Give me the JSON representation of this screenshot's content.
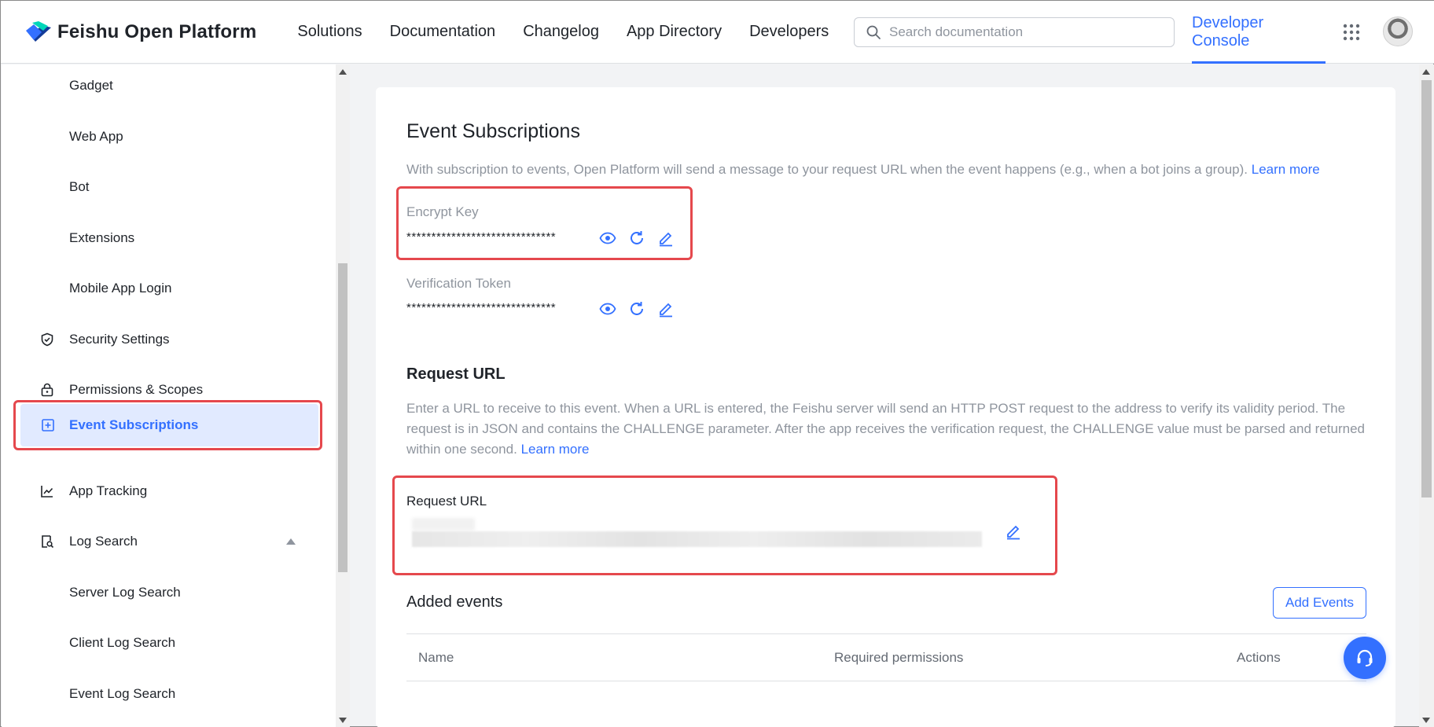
{
  "header": {
    "brand": "Feishu Open Platform",
    "nav": [
      "Solutions",
      "Documentation",
      "Changelog",
      "App Directory",
      "Developers"
    ],
    "search_placeholder": "Search documentation",
    "developer_console": "Developer Console"
  },
  "sidebar": {
    "items": [
      {
        "label": "Gadget",
        "icon": ""
      },
      {
        "label": "Web App",
        "icon": ""
      },
      {
        "label": "Bot",
        "icon": ""
      },
      {
        "label": "Extensions",
        "icon": ""
      },
      {
        "label": "Mobile App Login",
        "icon": ""
      },
      {
        "label": "Security Settings",
        "icon": "shield-check-icon"
      },
      {
        "label": "Permissions & Scopes",
        "icon": "lock-icon"
      },
      {
        "label": "Event Subscriptions",
        "icon": "plus-square-icon",
        "active": true
      },
      {
        "label": "App Tracking",
        "icon": "line-chart-icon"
      },
      {
        "label": "Log Search",
        "icon": "doc-search-icon",
        "expanded": true
      },
      {
        "label": "Server Log Search",
        "icon": ""
      },
      {
        "label": "Client Log Search",
        "icon": ""
      },
      {
        "label": "Event Log Search",
        "icon": ""
      }
    ]
  },
  "main": {
    "title": "Event Subscriptions",
    "description": "With subscription to events, Open Platform will send a message to your request URL when the event happens (e.g., when a bot joins a group).",
    "learn_more": "Learn more",
    "encrypt_key": {
      "label": "Encrypt Key",
      "value": "******************************"
    },
    "verification_token": {
      "label": "Verification Token",
      "value": "******************************"
    },
    "request_url_section": {
      "title": "Request URL",
      "description": "Enter a URL to receive to this event. When a URL is entered, the Feishu server will send an HTTP POST request to the address to verify its validity period. The request is in JSON and contains the CHALLENGE parameter. After the app receives the verification request, the CHALLENGE value must be parsed and returned within one second.",
      "learn_more": "Learn more",
      "field_label": "Request URL"
    },
    "added_events": {
      "title": "Added events",
      "add_button": "Add Events",
      "columns": [
        "Name",
        "Required permissions",
        "Actions"
      ]
    }
  },
  "colors": {
    "accent": "#3370ff",
    "highlight": "#e5484d",
    "active_bg": "#e1eaff"
  }
}
